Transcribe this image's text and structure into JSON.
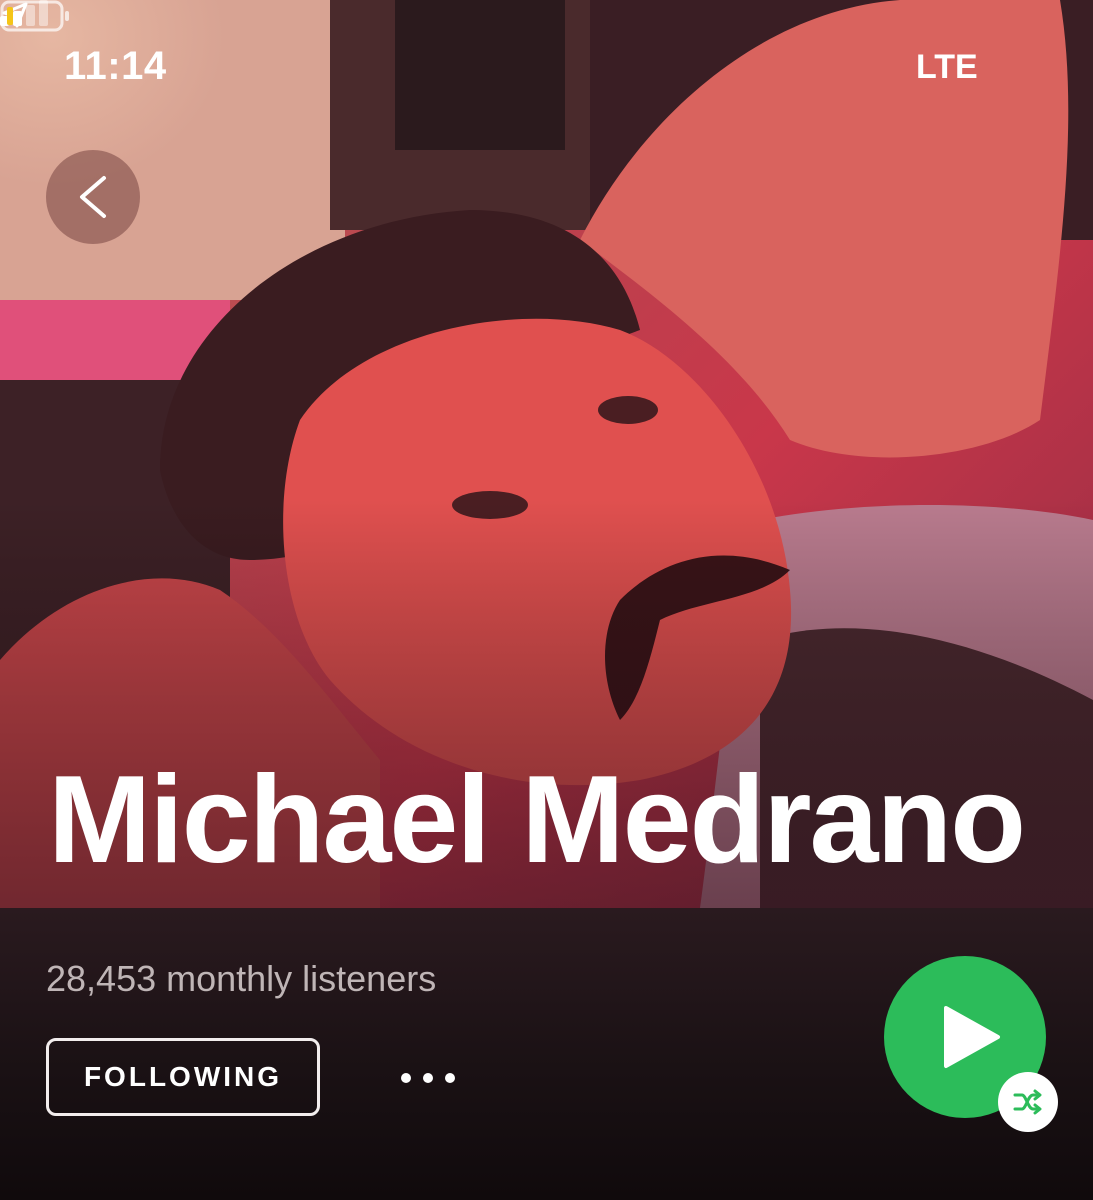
{
  "status_bar": {
    "time": "11:14",
    "network": "LTE",
    "location_icon": "location-arrow-icon",
    "signal_icon": "cellular-signal-icon",
    "battery_icon": "battery-low-icon",
    "battery_color": "#f5c518"
  },
  "header": {
    "back_icon": "chevron-left-icon"
  },
  "artist": {
    "name": "Michael Medrano",
    "monthly_listeners": "28,453 monthly listeners",
    "photo": "artist-cover-photo"
  },
  "actions": {
    "follow_label": "FOLLOWING",
    "more_icon": "more-dots-icon",
    "play_icon": "play-icon",
    "shuffle_icon": "shuffle-icon",
    "play_color": "#2cbc5a"
  }
}
